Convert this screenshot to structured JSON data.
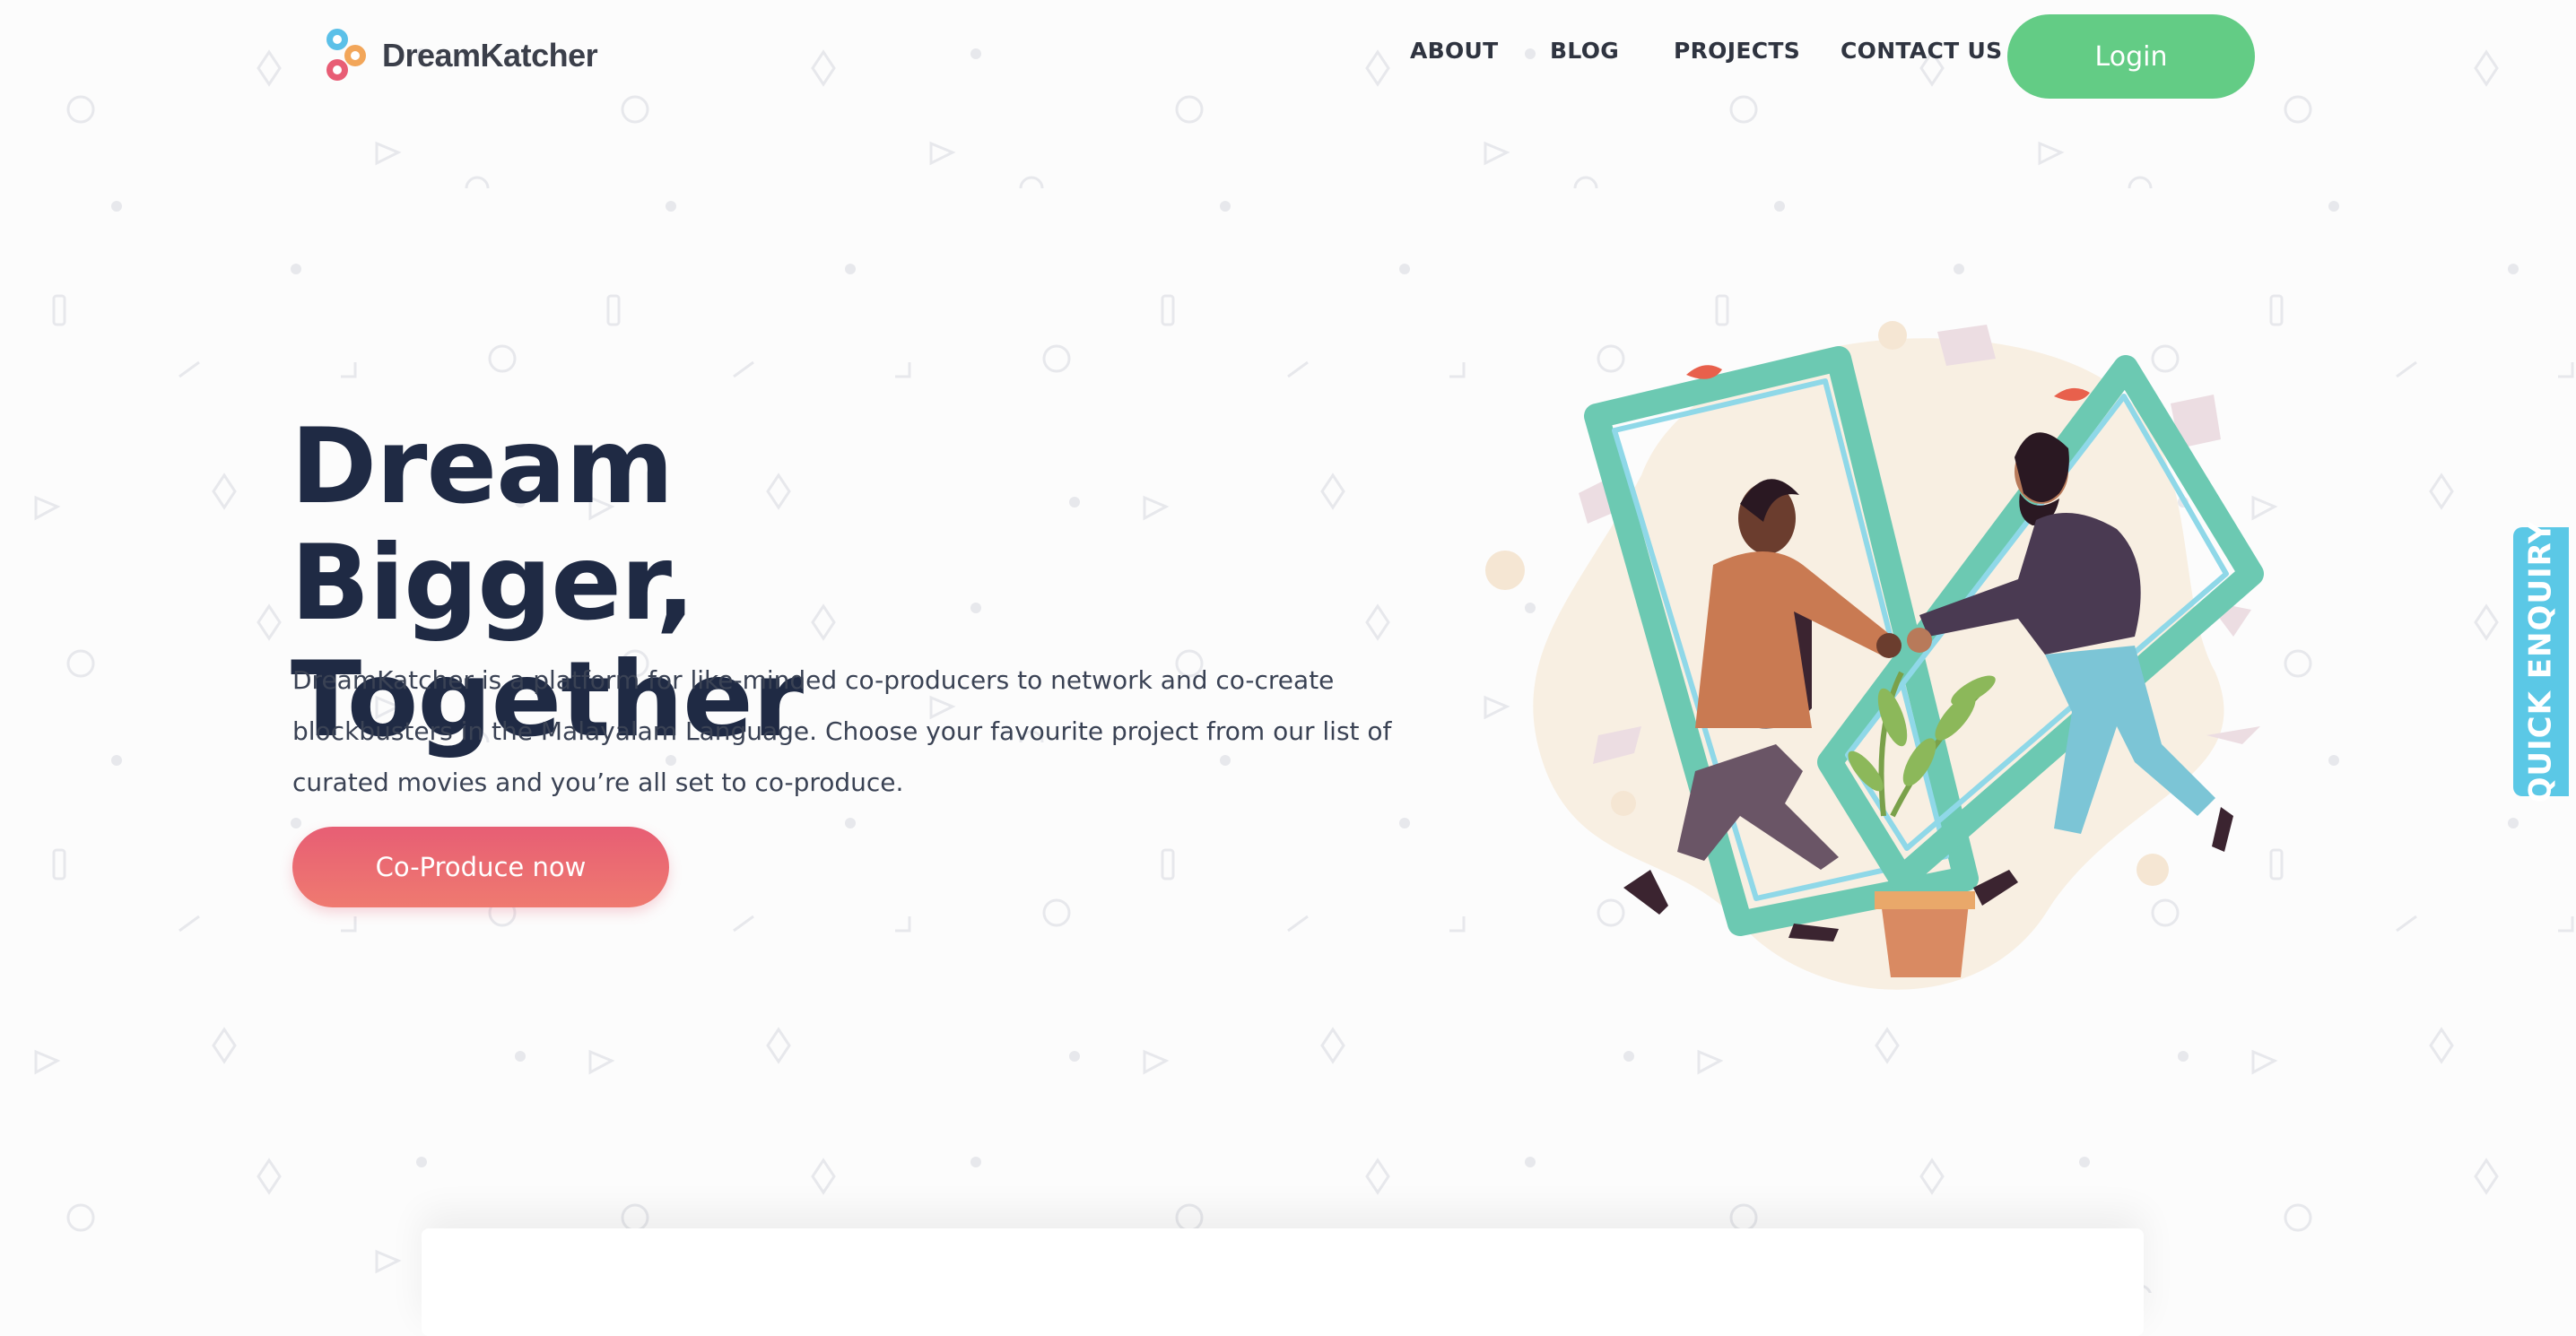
{
  "brand": {
    "name": "DreamKatcher",
    "logo_icon": "dreamkatcher-logo-icon"
  },
  "nav": {
    "items": [
      {
        "label": "ABOUT"
      },
      {
        "label": "BLOG"
      },
      {
        "label": "PROJECTS"
      },
      {
        "label": "CONTACT US"
      }
    ],
    "login_label": "Login"
  },
  "hero": {
    "title_line1": "Dream Bigger,",
    "title_line2": "Together",
    "description": "DreamKatcher is a platform for like-minded co-producers to network and co-create blockbusters in the Malayalam Language. Choose your favourite project from our list of curated movies and you’re all set to co-produce.",
    "cta_label": "Co-Produce now"
  },
  "side_tab": {
    "label": "QUICK ENQUIRY"
  },
  "colors": {
    "login_green": "#63cc85",
    "cta_red": "#e75e74",
    "title_navy": "#1f2a44",
    "enquiry_blue": "#5bc8e6"
  }
}
